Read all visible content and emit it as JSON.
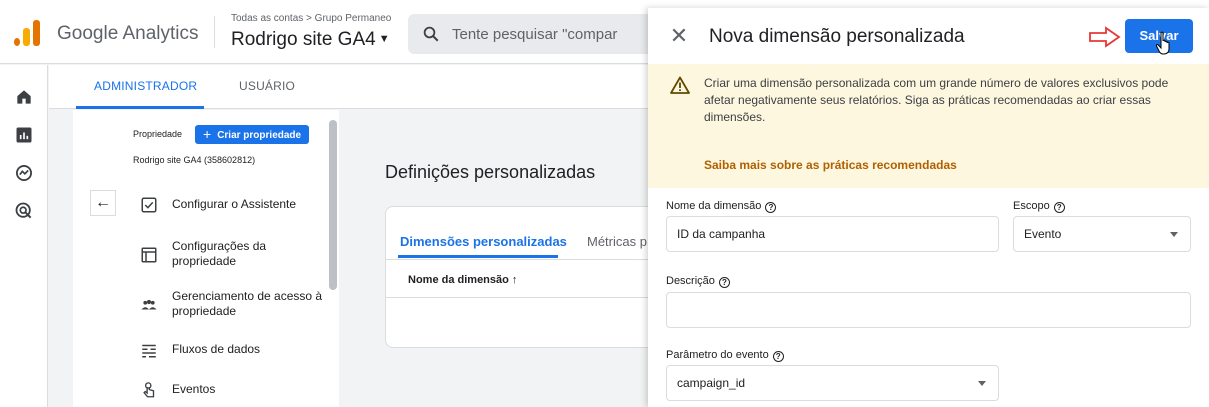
{
  "app": {
    "brand": "Google Analytics",
    "account_path": "Todas as contas > Grupo Permaneo",
    "property_name": "Rodrigo site GA4",
    "search_placeholder": "Tente pesquisar \"compar"
  },
  "admin_tabs": {
    "admin": "ADMINISTRADOR",
    "user": "USUÁRIO"
  },
  "admin_panel": {
    "property_label": "Propriedade",
    "create_property": "Criar propriedade",
    "property_id": "Rodrigo site GA4 (358602812)",
    "items": [
      {
        "label": "Configurar o Assistente",
        "icon": "checkbox-icon"
      },
      {
        "label": "Configurações da propriedade",
        "icon": "settings-window-icon"
      },
      {
        "label": "Gerenciamento de acesso à propriedade",
        "icon": "people-icon"
      },
      {
        "label": "Fluxos de dados",
        "icon": "streams-icon"
      },
      {
        "label": "Eventos",
        "icon": "touch-icon"
      }
    ]
  },
  "content": {
    "title": "Definições personalizadas",
    "tab_dimensions": "Dimensões personalizadas",
    "tab_metrics": "Métricas p",
    "col_dimension_name": "Nome da dimensão"
  },
  "sheet": {
    "title": "Nova dimensão personalizada",
    "save_label": "Salvar",
    "warning_text": "Criar uma dimensão personalizada com um grande número de valores exclusivos pode afetar negativamente seus relatórios. Siga as práticas recomendadas ao criar essas dimensões.",
    "warning_link": "Saiba mais sobre as práticas recomendadas",
    "fields": {
      "dimension_name_label": "Nome da dimensão",
      "dimension_name_value": "ID da campanha",
      "scope_label": "Escopo",
      "scope_value": "Evento",
      "description_label": "Descrição",
      "description_value": "",
      "event_param_label": "Parâmetro do evento",
      "event_param_value": "campaign_id"
    }
  },
  "colors": {
    "accent": "#1a73e8",
    "warning_bg": "#fef7e0",
    "warning_link": "#b06000",
    "annotation_arrow": "#e53935"
  }
}
